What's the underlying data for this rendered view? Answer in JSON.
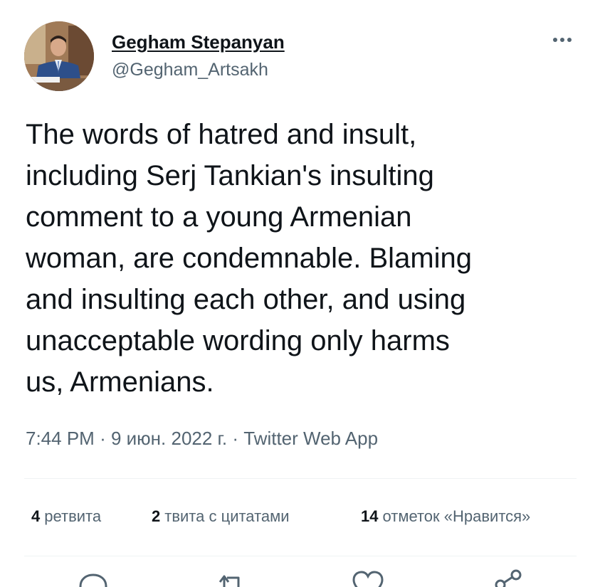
{
  "author": {
    "display_name": "Gegham Stepanyan",
    "handle": "@Gegham_Artsakh",
    "avatar_icon": "profile-photo"
  },
  "tweet": {
    "text": "The words of hatred and insult,\nincluding Serj Tankian's insulting\ncomment to a young Armenian\nwoman, are condemnable. Blaming\nand insulting each other, and using\nunacceptable wording only harms\nus, Armenians."
  },
  "meta": {
    "time": "7:44 PM",
    "date": "9 июн. 2022 г.",
    "separator": "·",
    "source": "Twitter Web App"
  },
  "stats": {
    "retweets": {
      "count": "4",
      "label": "ретвита"
    },
    "quotes": {
      "count": "2",
      "label": "твита с цитатами"
    },
    "likes": {
      "count": "14",
      "label": "отметок «Нравится»"
    }
  },
  "actions": {
    "reply_icon": "reply-icon",
    "retweet_icon": "retweet-icon",
    "like_icon": "heart-icon",
    "share_icon": "share-icon"
  },
  "colors": {
    "text_primary": "#0f1419",
    "text_secondary": "#536471",
    "divider": "#eff3f4"
  }
}
